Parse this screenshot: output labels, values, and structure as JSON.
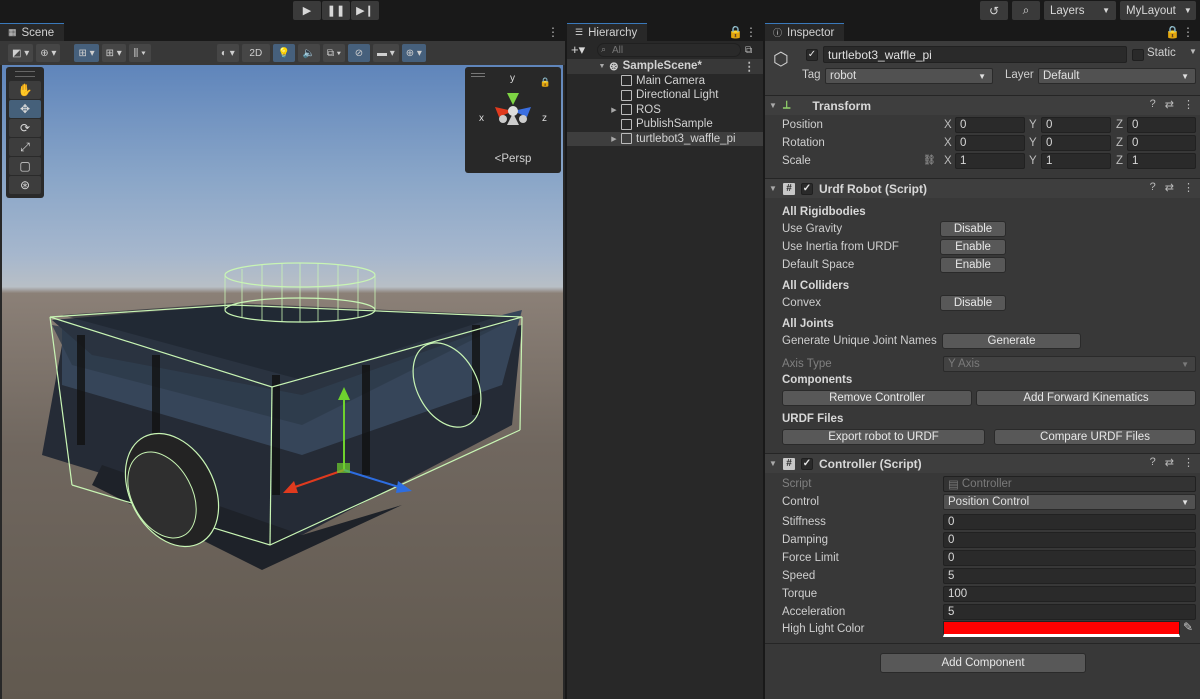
{
  "toolbar": {
    "play": "▶",
    "pause": "❚❚",
    "step": "▶❙",
    "layers_label": "Layers",
    "layout_label": "MyLayout"
  },
  "scene": {
    "tab_label": "Scene",
    "mode_2d": "2D",
    "gizmo_label": "Persp",
    "gizmo_axes": {
      "x": "x",
      "y": "y",
      "z": "z"
    }
  },
  "hierarchy": {
    "tab_label": "Hierarchy",
    "search_placeholder": "All",
    "scene_name": "SampleScene*",
    "items": [
      {
        "label": "Main Camera",
        "has_children": false
      },
      {
        "label": "Directional Light",
        "has_children": false
      },
      {
        "label": "ROS",
        "has_children": true
      },
      {
        "label": "PublishSample",
        "has_children": false
      },
      {
        "label": "turtlebot3_waffle_pi",
        "has_children": true
      }
    ]
  },
  "inspector": {
    "tab_label": "Inspector",
    "object_name": "turtlebot3_waffle_pi",
    "static_label": "Static",
    "tag_label": "Tag",
    "tag_value": "robot",
    "layer_label": "Layer",
    "layer_value": "Default",
    "transform": {
      "title": "Transform",
      "rows": [
        {
          "label": "Position",
          "x": "0",
          "y": "0",
          "z": "0"
        },
        {
          "label": "Rotation",
          "x": "0",
          "y": "0",
          "z": "0"
        },
        {
          "label": "Scale",
          "x": "1",
          "y": "1",
          "z": "1"
        }
      ]
    },
    "urdf": {
      "title": "Urdf Robot (Script)",
      "all_rigidbodies": "All Rigidbodies",
      "use_gravity": "Use Gravity",
      "use_gravity_btn": "Disable",
      "use_inertia": "Use Inertia from URDF",
      "use_inertia_btn": "Enable",
      "default_space": "Default Space",
      "default_space_btn": "Enable",
      "all_colliders": "All Colliders",
      "convex": "Convex",
      "convex_btn": "Disable",
      "all_joints": "All Joints",
      "gen_names": "Generate Unique Joint Names",
      "gen_btn": "Generate",
      "axis_type": "Axis Type",
      "axis_value": "Y Axis",
      "components": "Components",
      "remove_controller": "Remove Controller",
      "add_fk": "Add Forward Kinematics",
      "urdf_files": "URDF Files",
      "export_btn": "Export robot to URDF",
      "compare_btn": "Compare URDF Files"
    },
    "controller": {
      "title": "Controller (Script)",
      "script_label": "Script",
      "script_value": "Controller",
      "control_label": "Control",
      "control_value": "Position Control",
      "fields": [
        {
          "label": "Stiffness",
          "value": "0"
        },
        {
          "label": "Damping",
          "value": "0"
        },
        {
          "label": "Force Limit",
          "value": "0"
        },
        {
          "label": "Speed",
          "value": "5"
        },
        {
          "label": "Torque",
          "value": "100"
        },
        {
          "label": "Acceleration",
          "value": "5"
        }
      ],
      "highlight_label": "High Light Color",
      "highlight_color": "#ff0000"
    },
    "add_component": "Add Component"
  },
  "colors": {
    "accent": "#3a79bb",
    "selection": "#46607c",
    "robot_outline": "#c8f5b4"
  }
}
